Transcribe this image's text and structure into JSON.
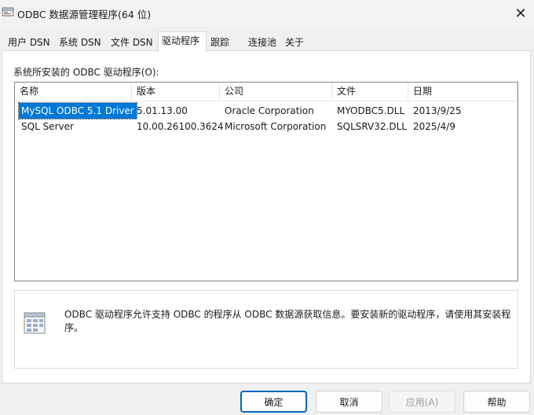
{
  "window": {
    "title": "ODBC 数据源管理程序(64 位)",
    "close_glyph": "✕"
  },
  "tabs": [
    {
      "label": "用户 DSN",
      "active": false
    },
    {
      "label": "系统 DSN",
      "active": false
    },
    {
      "label": "文件 DSN",
      "active": false
    },
    {
      "label": "驱动程序",
      "active": true
    },
    {
      "label": "跟踪",
      "active": false
    },
    {
      "label": "连接池",
      "active": false
    },
    {
      "label": "关于",
      "active": false
    }
  ],
  "drivers": {
    "caption": "系统所安装的 ODBC 驱动程序(O):",
    "columns": [
      "名称",
      "版本",
      "公司",
      "文件",
      "日期"
    ],
    "rows": [
      [
        "MySQL ODBC 5.1 Driver",
        "5.01.13.00",
        "Oracle Corporation",
        "MYODBC5.DLL",
        "2013/9/25"
      ],
      [
        "SQL Server",
        "10.00.26100.3624",
        "Microsoft Corporation",
        "SQLSRV32.DLL",
        "2025/4/9"
      ]
    ],
    "selected_row": 0
  },
  "info": {
    "icon": "driver-document-icon",
    "text": "ODBC 驱动程序允许支持 ODBC 的程序从 ODBC 数据源获取信息。要安装新的驱动程序，请使用其安装程序。"
  },
  "buttons": {
    "ok": "确定",
    "cancel": "取消",
    "apply": "应用(A)",
    "help": "帮助"
  },
  "colors": {
    "selection": "#0078d7",
    "default_button_border": "#0067c0"
  }
}
